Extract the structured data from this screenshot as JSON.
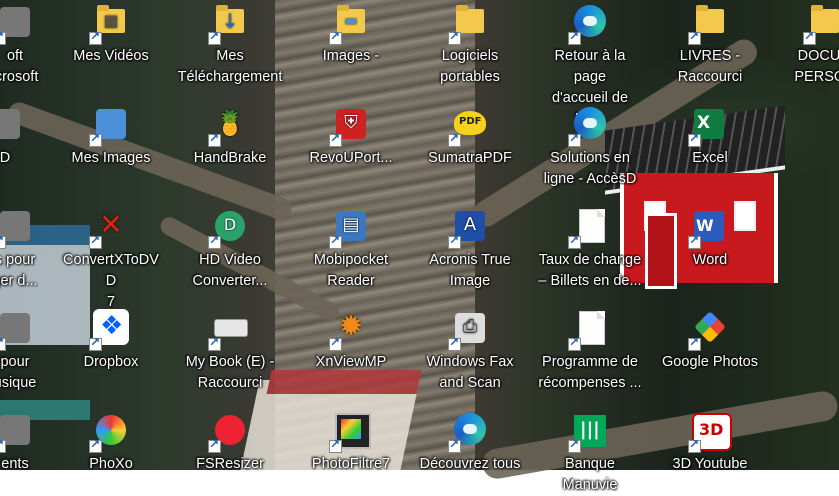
{
  "desktop": {
    "icons": [
      {
        "id": "soft",
        "label": "oft\nicrosoft",
        "icon": "generic-app-icon"
      },
      {
        "id": "mes-videos",
        "label": "Mes Vidéos",
        "icon": "video-folder-icon"
      },
      {
        "id": "mes-telechargement",
        "label": "Mes\nTéléchargement",
        "icon": "download-folder-icon"
      },
      {
        "id": "images",
        "label": "Images -",
        "icon": "pictures-folder-icon"
      },
      {
        "id": "logiciels-portables",
        "label": "Logiciels\nportables",
        "icon": "folder-icon"
      },
      {
        "id": "retour-page",
        "label": "Retour à la page\nd'accueil de De...",
        "icon": "edge-icon"
      },
      {
        "id": "livres",
        "label": "LIVRES -\nRaccourci",
        "icon": "folder-icon"
      },
      {
        "id": "documents-perso",
        "label": "DOCUM\nPERSON",
        "icon": "folder-icon"
      },
      {
        "id": "d-left",
        "label": "D",
        "icon": "generic-app-icon"
      },
      {
        "id": "mes-images",
        "label": "Mes Images",
        "icon": "image-viewer-icon"
      },
      {
        "id": "handbrake",
        "label": "HandBrake",
        "icon": "handbrake-icon"
      },
      {
        "id": "revouport",
        "label": "RevoUPort...",
        "icon": "revo-uninstaller-icon"
      },
      {
        "id": "sumatrapdf",
        "label": "SumatraPDF",
        "icon": "sumatra-pdf-icon"
      },
      {
        "id": "solutions-en-ligne",
        "label": "Solutions en\nligne - AccèsD",
        "icon": "edge-icon"
      },
      {
        "id": "excel",
        "label": "Excel",
        "icon": "excel-icon"
      },
      {
        "id": "s-pour",
        "label": "s pour\nger d...",
        "icon": "generic-app-icon"
      },
      {
        "id": "convertxtodvd",
        "label": "ConvertXToDVD\n7",
        "icon": "convertx-icon"
      },
      {
        "id": "hd-video",
        "label": "HD Video\nConverter...",
        "icon": "hd-video-icon"
      },
      {
        "id": "mobipocket",
        "label": "Mobipocket\nReader",
        "icon": "mobipocket-icon"
      },
      {
        "id": "acronis",
        "label": "Acronis True\nImage",
        "icon": "acronis-icon"
      },
      {
        "id": "taux-de-change",
        "label": "Taux de change\n– Billets en de...",
        "icon": "document-icon"
      },
      {
        "id": "word",
        "label": "Word",
        "icon": "word-icon"
      },
      {
        "id": "pour-musique",
        "label": "pour\nusique",
        "icon": "generic-app-icon"
      },
      {
        "id": "dropbox",
        "label": "Dropbox",
        "icon": "dropbox-icon"
      },
      {
        "id": "my-book",
        "label": "My Book (E) -\nRaccourci",
        "icon": "drive-icon"
      },
      {
        "id": "xnviewmp",
        "label": "XnViewMP",
        "icon": "xnview-icon"
      },
      {
        "id": "windows-fax",
        "label": "Windows Fax\nand Scan",
        "icon": "fax-icon"
      },
      {
        "id": "programme-recompenses",
        "label": "Programme de\nrécompenses ...",
        "icon": "document-icon"
      },
      {
        "id": "google-photos",
        "label": "Google Photos",
        "icon": "google-photos-icon"
      },
      {
        "id": "ents",
        "label": "ents",
        "icon": "generic-app-icon"
      },
      {
        "id": "phoxo",
        "label": "PhoXo",
        "icon": "phoxo-icon"
      },
      {
        "id": "fsresizer",
        "label": "FSResizer",
        "icon": "fsresizer-icon"
      },
      {
        "id": "photofiltre",
        "label": "PhotoFiltre7",
        "icon": "photofiltre-icon"
      },
      {
        "id": "decouvrez",
        "label": "Découvrez tous",
        "icon": "edge-icon"
      },
      {
        "id": "banque-manulife",
        "label": "Banque Manuvie",
        "icon": "manulife-icon"
      },
      {
        "id": "3d-youtube",
        "label": "3D Youtube",
        "icon": "youtube-3d-icon"
      }
    ]
  }
}
